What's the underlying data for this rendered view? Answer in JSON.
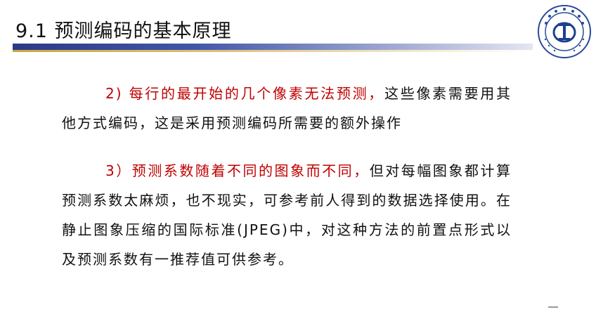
{
  "header": {
    "title": "9.1  预测编码的基本原理"
  },
  "content": {
    "para1_red": "2)  每行的最开始的几个像素无法预测，",
    "para1_black": "这些像素需要用其他方式编码，这是采用预测编码所需要的额外操作",
    "para2_red": "3）预测系数随着不同的图象而不同，",
    "para2_black": "但对每幅图象都计算预测系数太麻烦，也不现实，可参考前人得到的数据选择使用。在静止图象压缩的国际标准(JPEG)中，对这种方法的前置点形式以及预测系数有一推荐值可供参考。"
  },
  "logo": {
    "icon": "university-emblem-icon",
    "colors": {
      "ring": "#2a4a9a",
      "inner": "#1f3f8f"
    }
  },
  "colors": {
    "title_bar": "#2a3a86",
    "accent_gold": "#c9a640",
    "highlight_red": "#c00000",
    "text": "#111111"
  }
}
